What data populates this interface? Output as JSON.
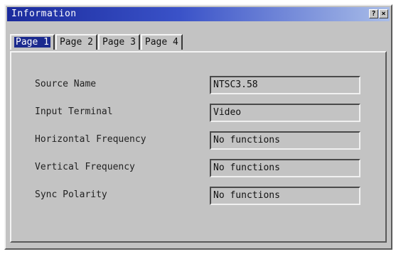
{
  "window": {
    "title": "Information",
    "help_button": "?",
    "close_button": "×"
  },
  "tabs": [
    {
      "label": "Page 1",
      "active": true
    },
    {
      "label": "Page 2",
      "active": false
    },
    {
      "label": "Page 3",
      "active": false
    },
    {
      "label": "Page 4",
      "active": false
    }
  ],
  "fields": [
    {
      "label": "Source Name",
      "value": "NTSC3.58"
    },
    {
      "label": "Input Terminal",
      "value": "Video"
    },
    {
      "label": "Horizontal Frequency",
      "value": "No functions"
    },
    {
      "label": "Vertical Frequency",
      "value": "No functions"
    },
    {
      "label": "Sync Polarity",
      "value": "No functions"
    }
  ],
  "colors": {
    "title_bar_start": "#1a2a9c",
    "title_bar_end": "#a9bde8",
    "face": "#c3c3c3",
    "active_tab_highlight": "#1b2a8e"
  }
}
